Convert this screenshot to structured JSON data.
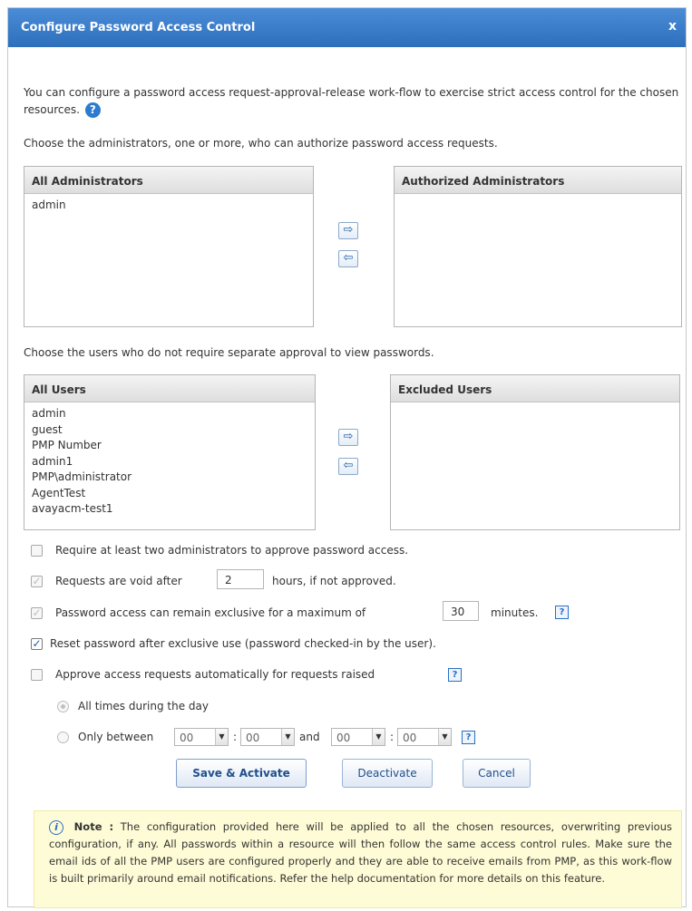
{
  "dialog": {
    "title": "Configure Password Access Control",
    "close": "x"
  },
  "intro": {
    "text": "You can configure a password access request-approval-release work-flow to exercise strict access control for the chosen resources.",
    "help": "?"
  },
  "admins": {
    "prompt": "Choose the administrators, one or more, who can authorize password access requests.",
    "all_header": "All Administrators",
    "all_items": [
      "admin"
    ],
    "authorized_header": "Authorized Administrators",
    "authorized_items": [],
    "move_right": "⇨",
    "move_left": "⇦"
  },
  "users": {
    "prompt": "Choose the users who do not require separate approval to view passwords.",
    "all_header": "All Users",
    "all_items": [
      "admin",
      "guest",
      "PMP Number",
      "admin1",
      "PMP\\administrator",
      "AgentTest",
      "avayacm-test1"
    ],
    "excluded_header": "Excluded Users",
    "excluded_items": [],
    "move_right": "⇨",
    "move_left": "⇦"
  },
  "options": {
    "require_two": {
      "label": "Require at least two administrators to approve password access.",
      "checked": false
    },
    "void_after": {
      "prefix": "Requests are void after",
      "value": "2",
      "suffix": "hours, if not approved.",
      "checked": true
    },
    "exclusive_max": {
      "prefix": "Password access can remain exclusive for a maximum of",
      "value": "30",
      "suffix": "minutes.",
      "checked": true,
      "help": "?"
    },
    "reset_after": {
      "label": "Reset password after exclusive use (password checked-in by the user).",
      "checked": true
    },
    "auto_approve": {
      "label": "Approve access requests automatically for requests raised",
      "checked": false,
      "help": "?"
    }
  },
  "schedule": {
    "all_times_label": "All times during the day",
    "only_between_label": "Only between",
    "start_hour": "00",
    "start_min": "00",
    "and_label": "and",
    "end_hour": "00",
    "end_min": "00",
    "colon": ":",
    "help": "?"
  },
  "buttons": {
    "save": "Save & Activate",
    "deactivate": "Deactivate",
    "cancel": "Cancel"
  },
  "note": {
    "icon": "i",
    "label": "Note :",
    "text": "The configuration provided here will be applied to all the chosen resources, overwriting previous configuration, if any. All passwords within a resource will then follow the same access control rules. Make sure the email ids of all the PMP users are configured properly and they are able to receive emails from PMP, as this work-flow is built primarily around email notifications. Refer the help documentation for more details on this feature."
  },
  "icons": {
    "close": "close-icon",
    "help": "help-icon",
    "info": "info-icon",
    "arrow_right": "arrow-right-icon",
    "arrow_left": "arrow-left-icon",
    "dropdown": "chevron-down-icon"
  },
  "colors": {
    "titlebar": "#2e6fbd",
    "note_bg": "#fefcd6",
    "accent": "#2b7bd0"
  }
}
